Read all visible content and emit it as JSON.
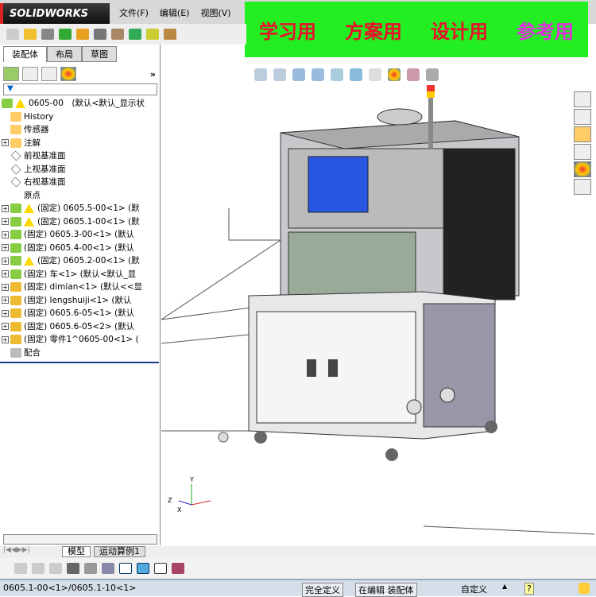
{
  "app": {
    "logo": "SOLIDWORKS",
    "menu": [
      "文件(F)",
      "编辑(E)",
      "视图(V)"
    ]
  },
  "banner": {
    "items": [
      {
        "text": "学习用",
        "color": "#e8102a"
      },
      {
        "text": "方案用",
        "color": "#e8102a"
      },
      {
        "text": "设计用",
        "color": "#e8102a"
      },
      {
        "text": "参考用",
        "color": "#e030e0"
      }
    ]
  },
  "panel": {
    "tabs": [
      "装配体",
      "布局",
      "草图"
    ],
    "more": "»",
    "filter": "▼"
  },
  "tree": [
    {
      "label": "0605-00　(默认<默认_显示状",
      "icon": "assembly",
      "warn": true,
      "exp": false,
      "root": true
    },
    {
      "label": "History",
      "icon": "history"
    },
    {
      "label": "传感器",
      "icon": "sensor"
    },
    {
      "label": "注解",
      "icon": "annotation",
      "exp": true
    },
    {
      "label": "前视基准面",
      "icon": "plane"
    },
    {
      "label": "上视基准面",
      "icon": "plane"
    },
    {
      "label": "右视基准面",
      "icon": "plane"
    },
    {
      "label": "原点",
      "icon": "origin"
    },
    {
      "label": "(固定) 0605.5-00<1> (默",
      "icon": "assembly",
      "warn": true,
      "exp": true
    },
    {
      "label": "(固定) 0605.1-00<1> (默",
      "icon": "assembly",
      "warn": true,
      "exp": true
    },
    {
      "label": "(固定) 0605.3-00<1> (默认",
      "icon": "assembly",
      "exp": true
    },
    {
      "label": "(固定) 0605.4-00<1> (默认",
      "icon": "assembly",
      "exp": true
    },
    {
      "label": "(固定) 0605.2-00<1> (默",
      "icon": "assembly",
      "warn": true,
      "exp": true
    },
    {
      "label": "(固定) 车<1> (默认<默认_显",
      "icon": "assembly",
      "exp": true
    },
    {
      "label": "(固定) dimian<1> (默认<<显",
      "icon": "part",
      "exp": true
    },
    {
      "label": "(固定) lengshuiji<1> (默认",
      "icon": "part",
      "exp": true
    },
    {
      "label": "(固定) 0605.6-05<1> (默认",
      "icon": "part",
      "exp": true
    },
    {
      "label": "(固定) 0605.6-05<2> (默认",
      "icon": "part",
      "exp": true
    },
    {
      "label": "(固定) 零件1^0605-00<1> (",
      "icon": "part",
      "exp": true
    },
    {
      "label": "配合",
      "icon": "mates"
    }
  ],
  "bottom_tabs": [
    "模型",
    "运动算例1"
  ],
  "status": {
    "path": "0605.1-00<1>/0605.1-10<1>",
    "defined": "完全定义",
    "editing": "在编辑 装配体",
    "units": "自定义",
    "help": "?"
  },
  "triad": {
    "x": "X",
    "y": "Y",
    "z": "Z"
  }
}
